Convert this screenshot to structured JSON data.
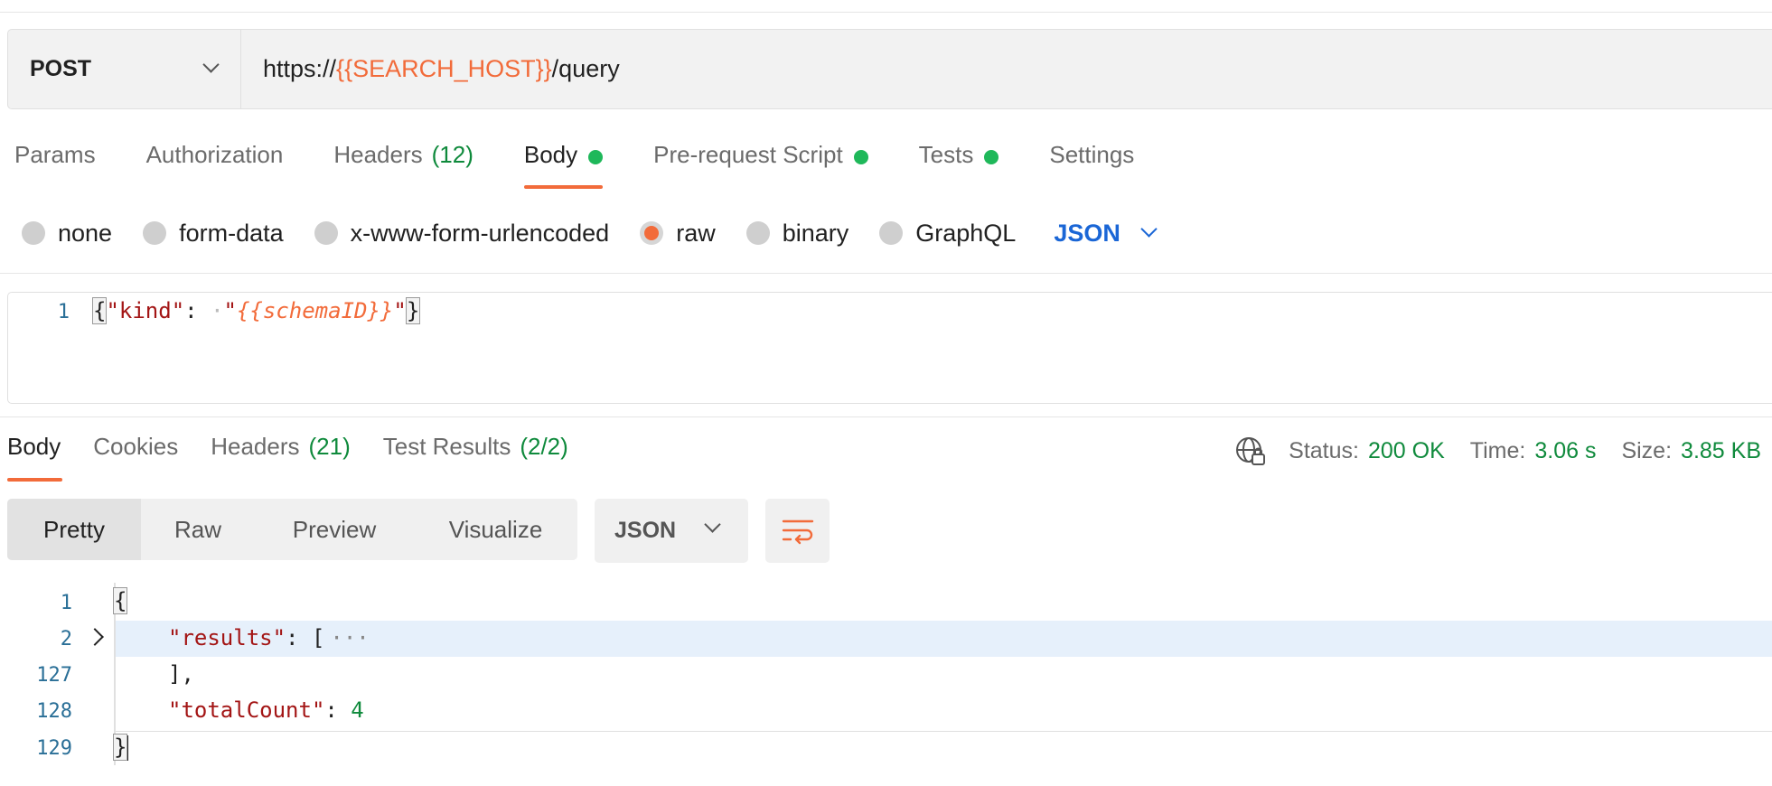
{
  "request": {
    "method": "POST",
    "url_prefix": "https://",
    "url_variable": "{{SEARCH_HOST}}",
    "url_suffix": "/query"
  },
  "request_tabs": [
    {
      "label": "Params"
    },
    {
      "label": "Authorization"
    },
    {
      "label": "Headers",
      "count": "(12)"
    },
    {
      "label": "Body",
      "dot": true,
      "active": true
    },
    {
      "label": "Pre-request Script",
      "dot": true
    },
    {
      "label": "Tests",
      "dot": true
    },
    {
      "label": "Settings"
    }
  ],
  "body_types": [
    "none",
    "form-data",
    "x-www-form-urlencoded",
    "raw",
    "binary",
    "GraphQL"
  ],
  "body_type_selected": "raw",
  "body_language": "JSON",
  "request_body": {
    "line_number": "1",
    "open_brace": "{",
    "key": "\"kind\"",
    "colon": ":",
    "whitespace_marker": "·",
    "open_quote": "\"",
    "value_variable": "{{schemaID}}",
    "close_quote": "\"",
    "close_brace": "}"
  },
  "response_tabs": [
    {
      "label": "Body",
      "active": true
    },
    {
      "label": "Cookies"
    },
    {
      "label": "Headers",
      "count": "(21)"
    },
    {
      "label": "Test Results",
      "count": "(2/2)"
    }
  ],
  "response_status": {
    "status_label": "Status:",
    "status_value": "200 OK",
    "time_label": "Time:",
    "time_value": "3.06 s",
    "size_label": "Size:",
    "size_value": "3.85 KB"
  },
  "response_views": [
    "Pretty",
    "Raw",
    "Preview",
    "Visualize"
  ],
  "response_view_selected": "Pretty",
  "response_language": "JSON",
  "response_body": {
    "line_numbers": [
      "1",
      "2",
      "127",
      "128",
      "129"
    ],
    "open_brace": "{",
    "results_key": "\"results\"",
    "results_colon": ":",
    "results_open": "[",
    "folded_marker": "···",
    "results_close": "],",
    "total_key": "\"totalCount\"",
    "total_colon": ":",
    "total_value": "4",
    "close_brace": "}"
  },
  "colors": {
    "accent": "#f26b3a",
    "status_green": "#0f8a3c",
    "dot_green": "#1fb85a",
    "link_blue": "#1a66d6"
  }
}
